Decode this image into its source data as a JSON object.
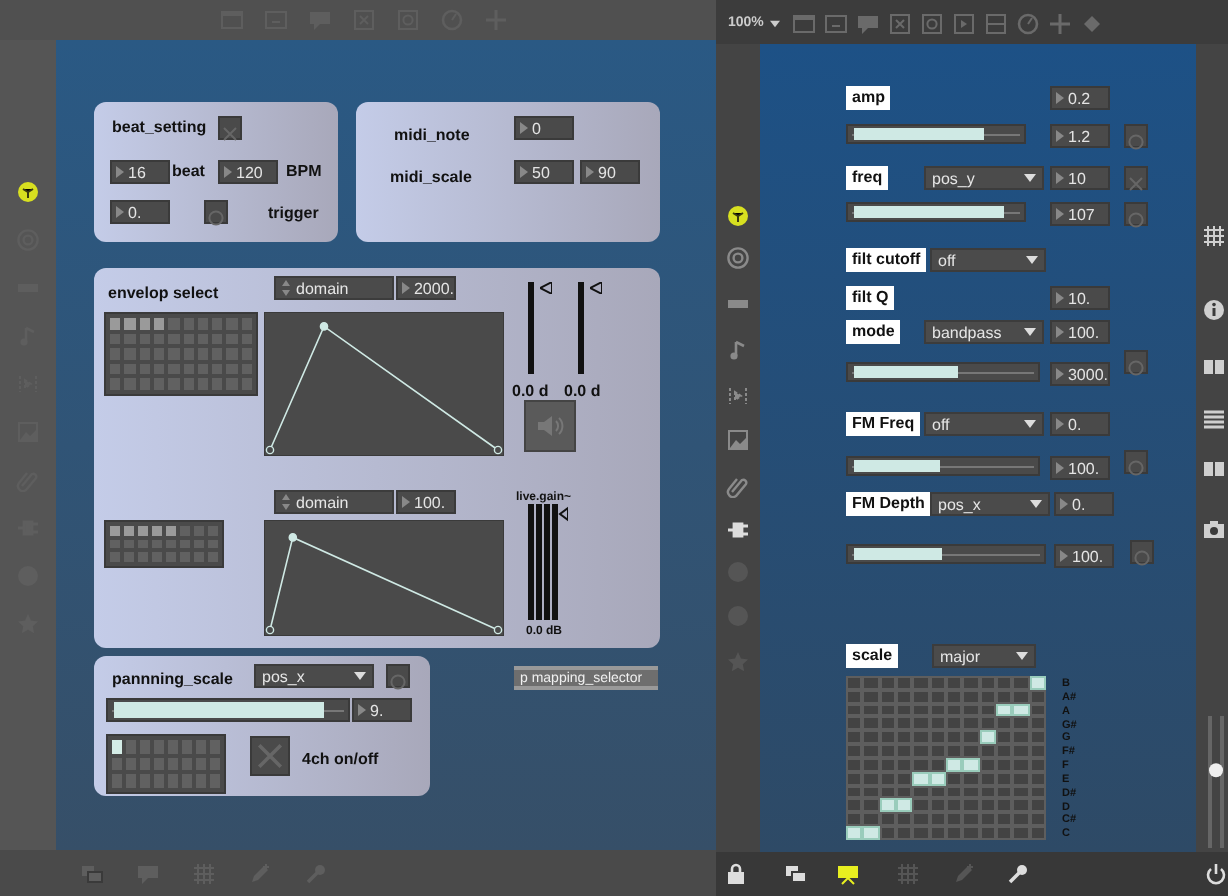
{
  "back_window": {
    "objects": [
      {
        "kind": "label",
        "text": "beat_setting"
      },
      {
        "kind": "toggle",
        "checked": false
      },
      {
        "kind": "number",
        "text": "16"
      },
      {
        "kind": "label",
        "text": "beat"
      },
      {
        "kind": "number",
        "text": "120"
      },
      {
        "kind": "label",
        "text": "BPM"
      },
      {
        "kind": "number",
        "text": "0."
      },
      {
        "kind": "bang"
      },
      {
        "kind": "label",
        "text": "trigger"
      },
      {
        "kind": "label",
        "text": "midi_note"
      },
      {
        "kind": "number",
        "text": "0"
      },
      {
        "kind": "label",
        "text": "midi_scale"
      },
      {
        "kind": "number",
        "text": "50"
      },
      {
        "kind": "number",
        "text": "90"
      },
      {
        "kind": "label",
        "text": "envelop select"
      },
      {
        "kind": "domain_menu",
        "text": "domain"
      },
      {
        "kind": "number",
        "text": "2000."
      },
      {
        "kind": "matrix",
        "rows": [
          [
            true,
            true,
            true,
            true,
            false,
            false,
            false,
            false,
            false,
            false
          ],
          [
            false,
            false,
            false,
            false,
            false,
            false,
            false,
            false,
            false,
            false
          ],
          [
            false,
            false,
            false,
            false,
            false,
            false,
            false,
            false,
            false,
            false
          ],
          [
            false,
            false,
            false,
            false,
            false,
            false,
            false,
            false,
            false,
            false
          ],
          [
            false,
            false,
            false,
            false,
            false,
            false,
            false,
            false,
            false,
            false
          ]
        ]
      },
      {
        "kind": "function"
      },
      {
        "kind": "vslider",
        "level": 1
      },
      {
        "kind": "vslider",
        "level": 1
      },
      {
        "kind": "label",
        "text": "0.0 d"
      },
      {
        "kind": "label",
        "text": "0.0 d"
      },
      {
        "kind": "speaker"
      },
      {
        "kind": "domain_menu",
        "text": "domain"
      },
      {
        "kind": "number",
        "text": "100."
      },
      {
        "kind": "small_label",
        "text": "live.gain~"
      },
      {
        "kind": "matrix",
        "rows": [
          [
            true,
            true,
            true,
            true,
            true,
            false,
            false,
            false
          ],
          [
            false,
            false,
            false,
            false,
            false,
            false,
            false,
            false
          ],
          [
            false,
            false,
            false,
            false,
            false,
            false,
            false,
            false
          ]
        ]
      },
      {
        "kind": "function"
      },
      {
        "kind": "meter"
      },
      {
        "kind": "small_label",
        "text": "0.0 dB"
      },
      {
        "kind": "label",
        "text": "pannning_scale"
      },
      {
        "kind": "menu",
        "text": "pos_x"
      },
      {
        "kind": "bang"
      },
      {
        "kind": "hslider",
        "level": 0.92
      },
      {
        "kind": "number",
        "text": "9."
      },
      {
        "kind": "matrix",
        "rows": [
          [
            true,
            false,
            false,
            false,
            false,
            false,
            false,
            false
          ],
          [
            false,
            false,
            false,
            false,
            false,
            false,
            false,
            false
          ],
          [
            false,
            false,
            false,
            false,
            false,
            false,
            false,
            false
          ]
        ]
      },
      {
        "kind": "toggle",
        "checked": false
      },
      {
        "kind": "label",
        "text": "4ch on/off"
      },
      {
        "kind": "object",
        "text": "p mapping_selector"
      }
    ]
  },
  "front_window": {
    "zoom": "100%",
    "volume": {
      "level": 0.6
    },
    "objects": [
      {
        "kind": "tag",
        "text": "amp"
      },
      {
        "kind": "number",
        "text": "0.2"
      },
      {
        "kind": "hslider",
        "level": 0.8
      },
      {
        "kind": "number",
        "text": "1.2"
      },
      {
        "kind": "bang"
      },
      {
        "kind": "tag",
        "text": "freq"
      },
      {
        "kind": "menu",
        "text": "pos_y"
      },
      {
        "kind": "number",
        "text": "10"
      },
      {
        "kind": "toggle",
        "checked": false
      },
      {
        "kind": "hslider",
        "level": 0.91
      },
      {
        "kind": "number",
        "text": "107"
      },
      {
        "kind": "bang"
      },
      {
        "kind": "tag",
        "text": "filt cutoff"
      },
      {
        "kind": "menu",
        "text": "off"
      },
      {
        "kind": "tag",
        "text": "filt Q"
      },
      {
        "kind": "number",
        "text": "10."
      },
      {
        "kind": "tag",
        "text": "mode"
      },
      {
        "kind": "menu",
        "text": "bandpass"
      },
      {
        "kind": "number",
        "text": "100."
      },
      {
        "kind": "hslider",
        "level": 0.6
      },
      {
        "kind": "number",
        "text": "3000."
      },
      {
        "kind": "bang"
      },
      {
        "kind": "tag",
        "text": "FM Freq"
      },
      {
        "kind": "menu",
        "text": "off"
      },
      {
        "kind": "number",
        "text": "0."
      },
      {
        "kind": "hslider",
        "level": 0.5
      },
      {
        "kind": "number",
        "text": "100."
      },
      {
        "kind": "bang"
      },
      {
        "kind": "tag",
        "text": "FM Depth"
      },
      {
        "kind": "menu",
        "text": "pos_x"
      },
      {
        "kind": "number",
        "text": "0."
      },
      {
        "kind": "hslider",
        "level": 0.5
      },
      {
        "kind": "number",
        "text": "100."
      },
      {
        "kind": "bang"
      },
      {
        "kind": "tag",
        "text": "scale"
      },
      {
        "kind": "menu",
        "text": "major"
      },
      {
        "kind": "pianoroll",
        "rows": [
          {
            "label": "B",
            "cells": [
              false,
              false,
              false,
              false,
              false,
              false,
              false,
              false,
              false,
              false,
              false,
              true
            ]
          },
          {
            "label": "A#",
            "cells": [
              false,
              false,
              false,
              false,
              false,
              false,
              false,
              false,
              false,
              false,
              false,
              false
            ]
          },
          {
            "label": "A",
            "cells": [
              false,
              false,
              false,
              false,
              false,
              false,
              false,
              false,
              false,
              true,
              true,
              false
            ]
          },
          {
            "label": "G#",
            "cells": [
              false,
              false,
              false,
              false,
              false,
              false,
              false,
              false,
              false,
              false,
              false,
              false
            ]
          },
          {
            "label": "G",
            "cells": [
              false,
              false,
              false,
              false,
              false,
              false,
              false,
              false,
              true,
              false,
              false,
              false
            ]
          },
          {
            "label": "F#",
            "cells": [
              false,
              false,
              false,
              false,
              false,
              false,
              false,
              false,
              false,
              false,
              false,
              false
            ]
          },
          {
            "label": "F",
            "cells": [
              false,
              false,
              false,
              false,
              false,
              false,
              true,
              true,
              false,
              false,
              false,
              false
            ]
          },
          {
            "label": "E",
            "cells": [
              false,
              false,
              false,
              false,
              true,
              true,
              false,
              false,
              false,
              false,
              false,
              false
            ]
          },
          {
            "label": "D#",
            "cells": [
              false,
              false,
              false,
              false,
              false,
              false,
              false,
              false,
              false,
              false,
              false,
              false
            ]
          },
          {
            "label": "D",
            "cells": [
              false,
              false,
              true,
              true,
              false,
              false,
              false,
              false,
              false,
              false,
              false,
              false
            ]
          },
          {
            "label": "C#",
            "cells": [
              false,
              false,
              false,
              false,
              false,
              false,
              false,
              false,
              false,
              false,
              false,
              false
            ]
          },
          {
            "label": "C",
            "cells": [
              true,
              true,
              false,
              false,
              false,
              false,
              false,
              false,
              false,
              false,
              false,
              false
            ]
          }
        ]
      }
    ]
  }
}
